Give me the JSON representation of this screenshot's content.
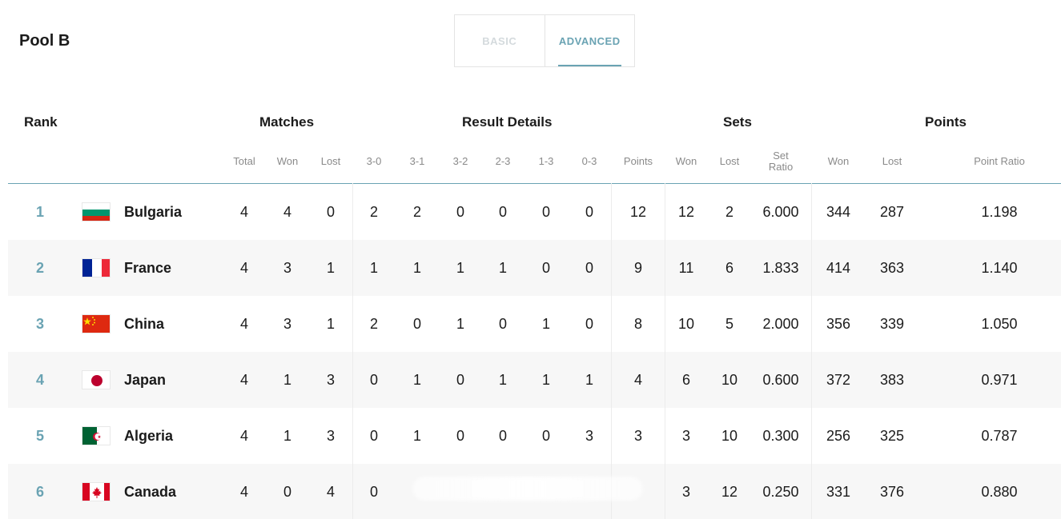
{
  "pool": {
    "title": "Pool B"
  },
  "toggle": {
    "basic": "BASIC",
    "advanced": "ADVANCED"
  },
  "headers": {
    "rank": "Rank",
    "matches": "Matches",
    "result_details": "Result Details",
    "sets": "Sets",
    "points": "Points",
    "total": "Total",
    "won": "Won",
    "lost": "Lost",
    "r30": "3-0",
    "r31": "3-1",
    "r32": "3-2",
    "r23": "2-3",
    "r13": "1-3",
    "r03": "0-3",
    "pts": "Points",
    "sets_won": "Won",
    "sets_lost": "Lost",
    "set_ratio_1": "Set",
    "set_ratio_2": "Ratio",
    "points_won": "Won",
    "points_lost": "Lost",
    "point_ratio": "Point Ratio"
  },
  "rows": [
    {
      "rank": "1",
      "team": "Bulgaria",
      "flag": "bulgaria-flag-icon",
      "total": "4",
      "won": "4",
      "lost": "0",
      "r30": "2",
      "r31": "2",
      "r32": "0",
      "r23": "0",
      "r13": "0",
      "r03": "0",
      "pts": "12",
      "sw": "12",
      "sl": "2",
      "sr": "6.000",
      "pw": "344",
      "pl": "287",
      "pr": "1.198"
    },
    {
      "rank": "2",
      "team": "France",
      "flag": "france-flag-icon",
      "total": "4",
      "won": "3",
      "lost": "1",
      "r30": "1",
      "r31": "1",
      "r32": "1",
      "r23": "1",
      "r13": "0",
      "r03": "0",
      "pts": "9",
      "sw": "11",
      "sl": "6",
      "sr": "1.833",
      "pw": "414",
      "pl": "363",
      "pr": "1.140"
    },
    {
      "rank": "3",
      "team": "China",
      "flag": "china-flag-icon",
      "total": "4",
      "won": "3",
      "lost": "1",
      "r30": "2",
      "r31": "0",
      "r32": "1",
      "r23": "0",
      "r13": "1",
      "r03": "0",
      "pts": "8",
      "sw": "10",
      "sl": "5",
      "sr": "2.000",
      "pw": "356",
      "pl": "339",
      "pr": "1.050"
    },
    {
      "rank": "4",
      "team": "Japan",
      "flag": "japan-flag-icon",
      "total": "4",
      "won": "1",
      "lost": "3",
      "r30": "0",
      "r31": "1",
      "r32": "0",
      "r23": "1",
      "r13": "1",
      "r03": "1",
      "pts": "4",
      "sw": "6",
      "sl": "10",
      "sr": "0.600",
      "pw": "372",
      "pl": "383",
      "pr": "0.971"
    },
    {
      "rank": "5",
      "team": "Algeria",
      "flag": "algeria-flag-icon",
      "total": "4",
      "won": "1",
      "lost": "3",
      "r30": "0",
      "r31": "1",
      "r32": "0",
      "r23": "0",
      "r13": "0",
      "r03": "3",
      "pts": "3",
      "sw": "3",
      "sl": "10",
      "sr": "0.300",
      "pw": "256",
      "pl": "325",
      "pr": "0.787"
    },
    {
      "rank": "6",
      "team": "Canada",
      "flag": "canada-flag-icon",
      "total": "4",
      "won": "0",
      "lost": "4",
      "r30": "0",
      "r31": "",
      "r32": "",
      "r23": "",
      "r13": "",
      "r03": "",
      "pts": "",
      "sw": "3",
      "sl": "12",
      "sr": "0.250",
      "pw": "331",
      "pl": "376",
      "pr": "0.880"
    }
  ],
  "colors": {
    "accent": "#6aa3b3",
    "alt_row": "#f7f7f7",
    "muted": "#8a8a8a"
  }
}
